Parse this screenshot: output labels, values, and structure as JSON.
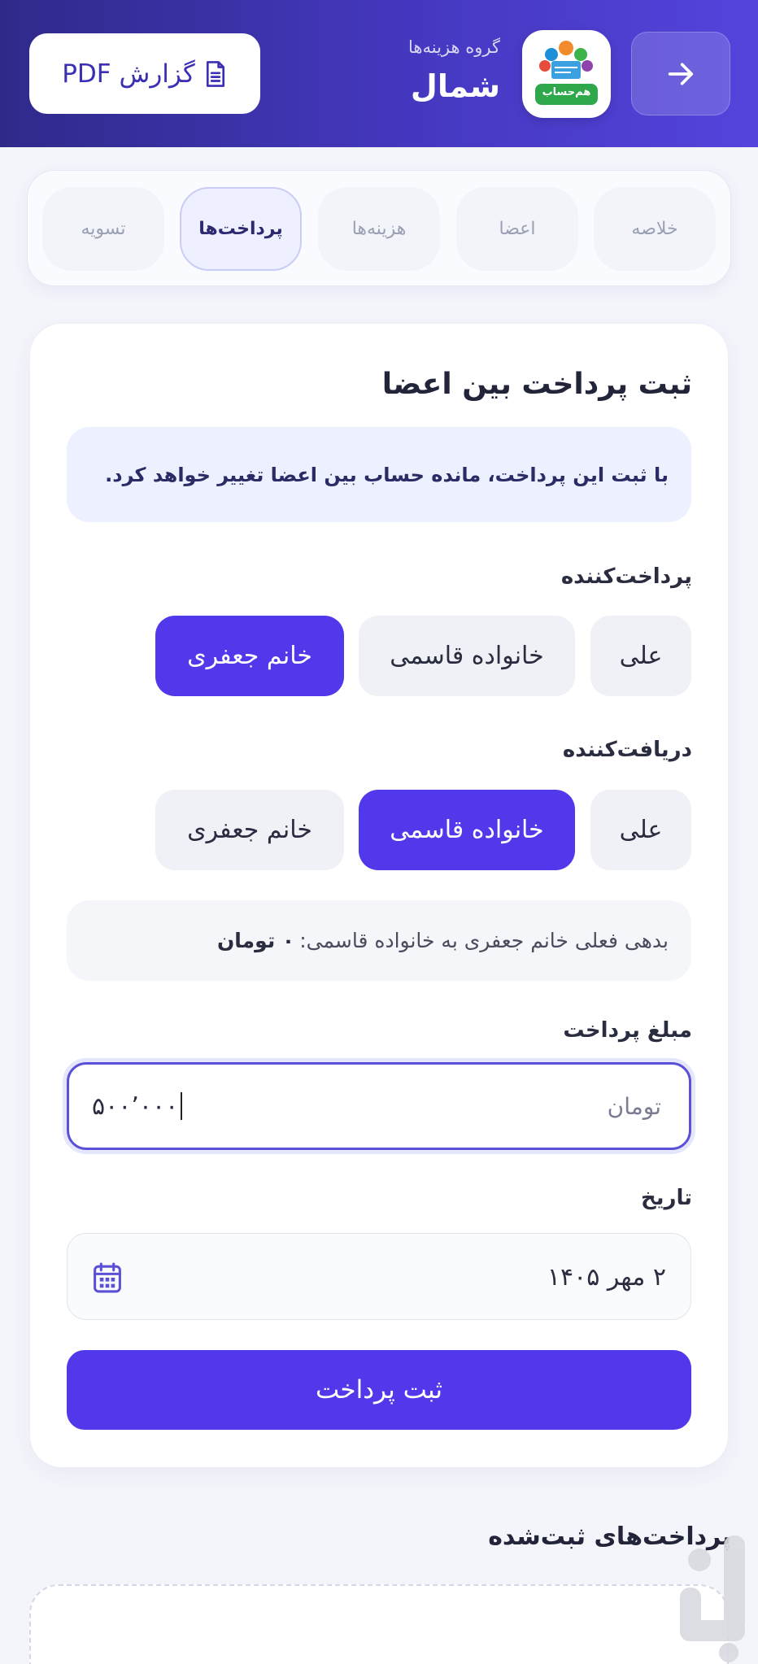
{
  "header": {
    "subtitle": "گروه هزینه‌ها",
    "title": "شمال",
    "pdf_button": "گزارش PDF",
    "logo_text": "هم‌حساب"
  },
  "tabs": [
    {
      "label": "خلاصه",
      "active": false
    },
    {
      "label": "اعضا",
      "active": false
    },
    {
      "label": "هزینه‌ها",
      "active": false
    },
    {
      "label": "پرداخت‌ها",
      "active": true
    },
    {
      "label": "تسویه",
      "active": false
    }
  ],
  "form": {
    "title": "ثبت پرداخت بین اعضا",
    "info": "با ثبت این پرداخت، مانده حساب بین اعضا تغییر خواهد کرد.",
    "payer_label": "پرداخت‌کننده",
    "payer_options": [
      "علی",
      "خانواده قاسمی",
      "خانم جعفری"
    ],
    "payer_selected": "خانم جعفری",
    "receiver_label": "دریافت‌کننده",
    "receiver_options": [
      "علی",
      "خانواده قاسمی",
      "خانم جعفری"
    ],
    "receiver_selected": "خانواده قاسمی",
    "debt_text": "بدهی فعلی خانم جعفری به خانواده قاسمی:",
    "debt_amount": "۰ تومان",
    "amount_label": "مبلغ پرداخت",
    "amount_unit": "تومان",
    "amount_value": "۵۰۰٬۰۰۰",
    "date_label": "تاریخ",
    "date_value": "۲ مهر ۱۴۰۵",
    "submit_label": "ثبت پرداخت"
  },
  "payments_list": {
    "title": "پرداخت‌های ثبت‌شده"
  },
  "colors": {
    "accent": "#5138ea",
    "header_start": "#2f2a8a",
    "header_end": "#5444dc"
  }
}
